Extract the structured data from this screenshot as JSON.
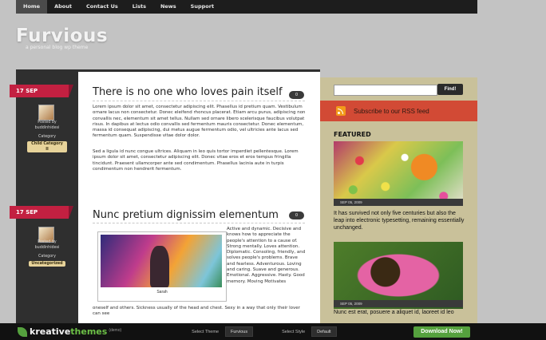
{
  "nav": {
    "items": [
      "Home",
      "About",
      "Contact Us",
      "Lists",
      "News",
      "Support"
    ]
  },
  "brand": {
    "name": "Furvious",
    "tagline": "a personal blog wp theme"
  },
  "posts": [
    {
      "day": "17",
      "month": "SEP",
      "title": "There is no one who loves pain itself",
      "comments": "0",
      "posted_by": "Posted by",
      "author": "buddinhidesi",
      "category_label": "Category",
      "category": "Child Category II",
      "para1": "Lorem ipsum dolor sit amet, consectetur adipiscing elit. Phasellus id pretium quam. Vestibulum ornare lacus non consectetur. Donec eleifend rhoncus placerat. Etiam arcu purus, adipiscing non convallis nec, elementum sit amet tellus. Nullam sed ornare libero scelerisque faucibus volutpat risus. In dapibus at lectus odio convallis sed fermentum mauris consectetur. Donec elementum, massa id consequat adipiscing, dui metus augue fermentum odio, vel ultricies ante lacus sed fermentum quam. Suspendisse vitae dolor dolor.",
      "para2": "Sed a ligula id nunc congue ultrices. Aliquam in leo quis tortor imperdiet pellentesque. Lorem ipsum dolor sit amet, consectetur adipiscing elit. Donec vitae eros et eros tempus fringilla tincidunt. Praesent ullamcorper ante sed condimentum. Phasellus lacinia aute in turpis condimentum non hendrerit fermentum."
    },
    {
      "day": "17",
      "month": "SEP",
      "title": "Nunc pretium dignissim elementum",
      "comments": "0",
      "posted_by": "Posted by",
      "author": "buddinhidesi",
      "category_label": "Category",
      "category": "Uncategorized",
      "caption": "Sarah",
      "side_text": "Active and dynamic. Decisive and knows how to appreciate the people's attention to a cause of. Strong mentally. Loves attention. Diplomatic. Consoling, friendly, and solves people's problems. Brave and fearless. Adventurous. Loving and caring. Suave and generous. Emotional. Aggressive. Hasty. Good memory. Moving Motivates",
      "bottom_text": "oneself and others. Sickness usually of the head and chest. Sexy in a way that only their lover can see"
    }
  ],
  "sidebar": {
    "search_button": "Find!",
    "rss": "Subscribe to our RSS feed",
    "featured_label": "FEATURED",
    "featured": [
      {
        "date": "SEP 05, 2009",
        "title": "It has survived not only five centuries but also the leap into electronic typesetting, remaining essentially unchanged."
      },
      {
        "date": "SEP 05, 2009",
        "title": "Nunc est erat, posuere a aliquet id, laoreet id leo"
      }
    ]
  },
  "footer": {
    "logo_a": "kreative",
    "logo_b": "themes",
    "demo": "(demo)",
    "select_theme_label": "Select Theme",
    "theme": "Furvious",
    "select_style_label": "Select Style",
    "style": "Default",
    "download": "Download Now!"
  }
}
